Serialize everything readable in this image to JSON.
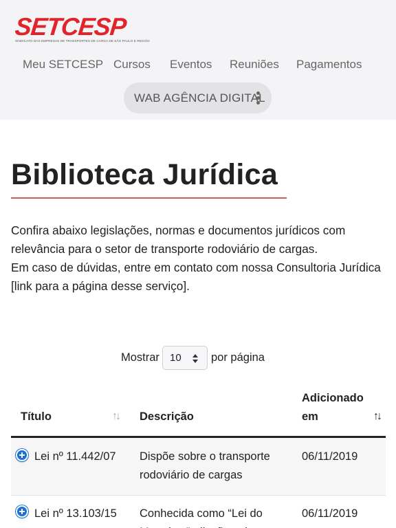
{
  "header": {
    "logo_text": "SETCESP",
    "logo_subtitle": "SINDICATO DAS EMPRESAS DE TRANSPORTES DE CARGA DE SÃO PAULO E REGIÃO",
    "nav": [
      "Meu SETCESP",
      "Cursos",
      "Eventos",
      "Reuniões",
      "Pagamentos"
    ],
    "account_label": "WAB AGÊNCIA DIGITAL",
    "account_icon": "kebab-menu-icon"
  },
  "main": {
    "title": "Biblioteca Jurídica",
    "intro": [
      "Confira abaixo legislações, normas e documentos jurídicos com relevância para o setor de transporte rodoviário de cargas.",
      "Em caso de dúvidas, entre em contato com nossa Consultoria Jurídica [link para a página desse serviço]."
    ],
    "accent_color": "#e05a4c"
  },
  "table": {
    "length_label_before": "Mostrar",
    "length_value": "10",
    "length_label_after": "por página",
    "columns": [
      "Título",
      "Descrição",
      "Adicionado em"
    ],
    "sort_icon": "↑↓",
    "rows": [
      {
        "title": "Lei nº 11.442/07",
        "description": "Dispõe sobre o transporte rodoviário de cargas",
        "added": "06/11/2019"
      },
      {
        "title": "Lei nº 13.103/15",
        "description": "Conhecida como “Lei do Motorista”, dispõe sobre",
        "added": "06/11/2019"
      }
    ],
    "expand_icon": "plus-circle-icon",
    "expand_color": "#1a6fd9"
  }
}
